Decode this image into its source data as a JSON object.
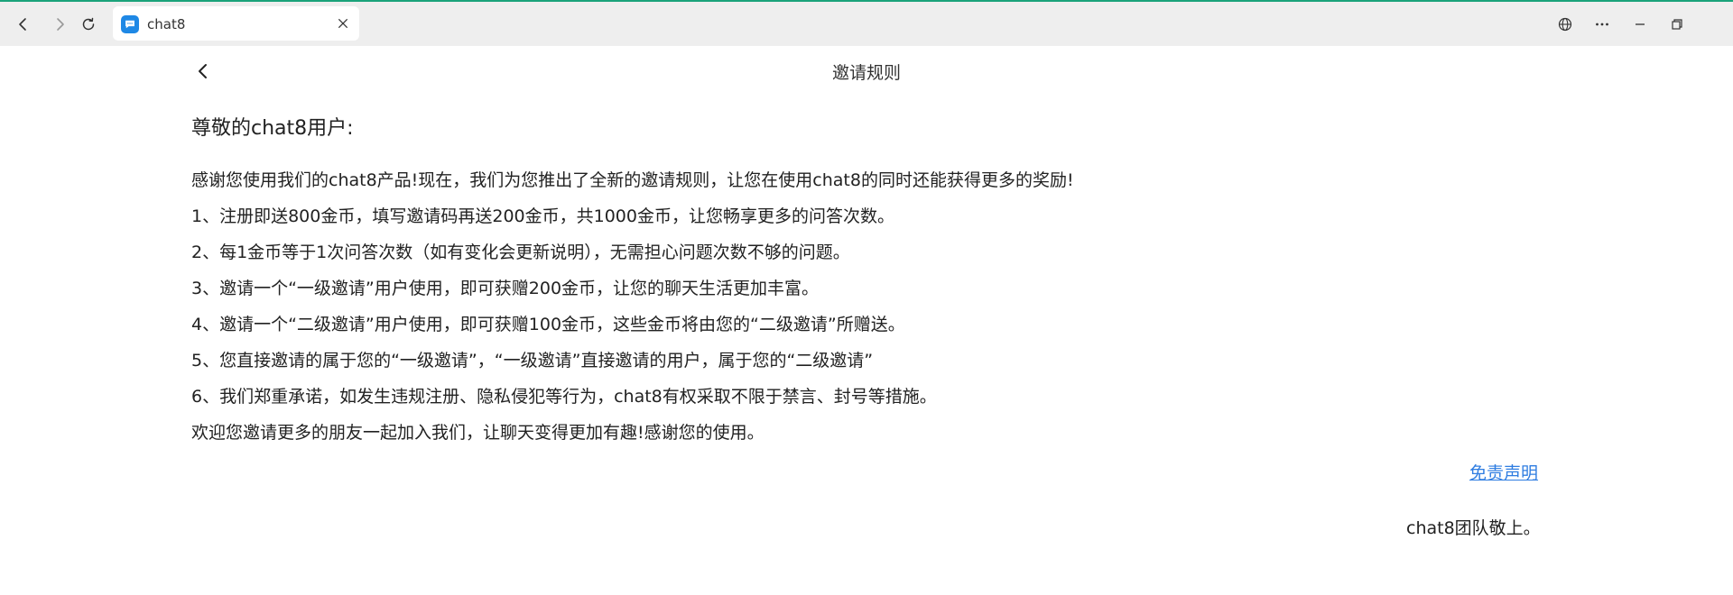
{
  "browser": {
    "tab_title": "chat8",
    "icons": {
      "back": "back-arrow-icon",
      "forward": "forward-arrow-icon",
      "reload": "reload-icon",
      "close": "close-icon",
      "language": "globe-icon",
      "more": "more-dots-icon",
      "minimize": "minimize-icon",
      "restore": "restore-icon"
    },
    "accent_color": "#1aa37a",
    "favicon_color": "#1e88e5"
  },
  "page": {
    "title": "邀请规则",
    "greeting": "尊敬的chat8用户:",
    "paragraphs": [
      "感谢您使用我们的chat8产品!现在，我们为您推出了全新的邀请规则，让您在使用chat8的同时还能获得更多的奖励!",
      "1、注册即送800金币，填写邀请码再送200金币，共1000金币，让您畅享更多的问答次数。",
      "2、每1金币等于1次问答次数（如有变化会更新说明），无需担心问题次数不够的问题。",
      "3、邀请一个“一级邀请”用户使用，即可获赠200金币，让您的聊天生活更加丰富。",
      "4、邀请一个“二级邀请”用户使用，即可获赠100金币，这些金币将由您的“二级邀请”所赠送。",
      "5、您直接邀请的属于您的“一级邀请”，“一级邀请”直接邀请的用户，属于您的“二级邀请”",
      "6、我们郑重承诺，如发生违规注册、隐私侵犯等行为，chat8有权采取不限于禁言、封号等措施。",
      "欢迎您邀请更多的朋友一起加入我们，让聊天变得更加有趣!感谢您的使用。"
    ],
    "disclaimer_link": "免责声明",
    "signature": "chat8团队敬上。",
    "link_color": "#2f7de1"
  }
}
